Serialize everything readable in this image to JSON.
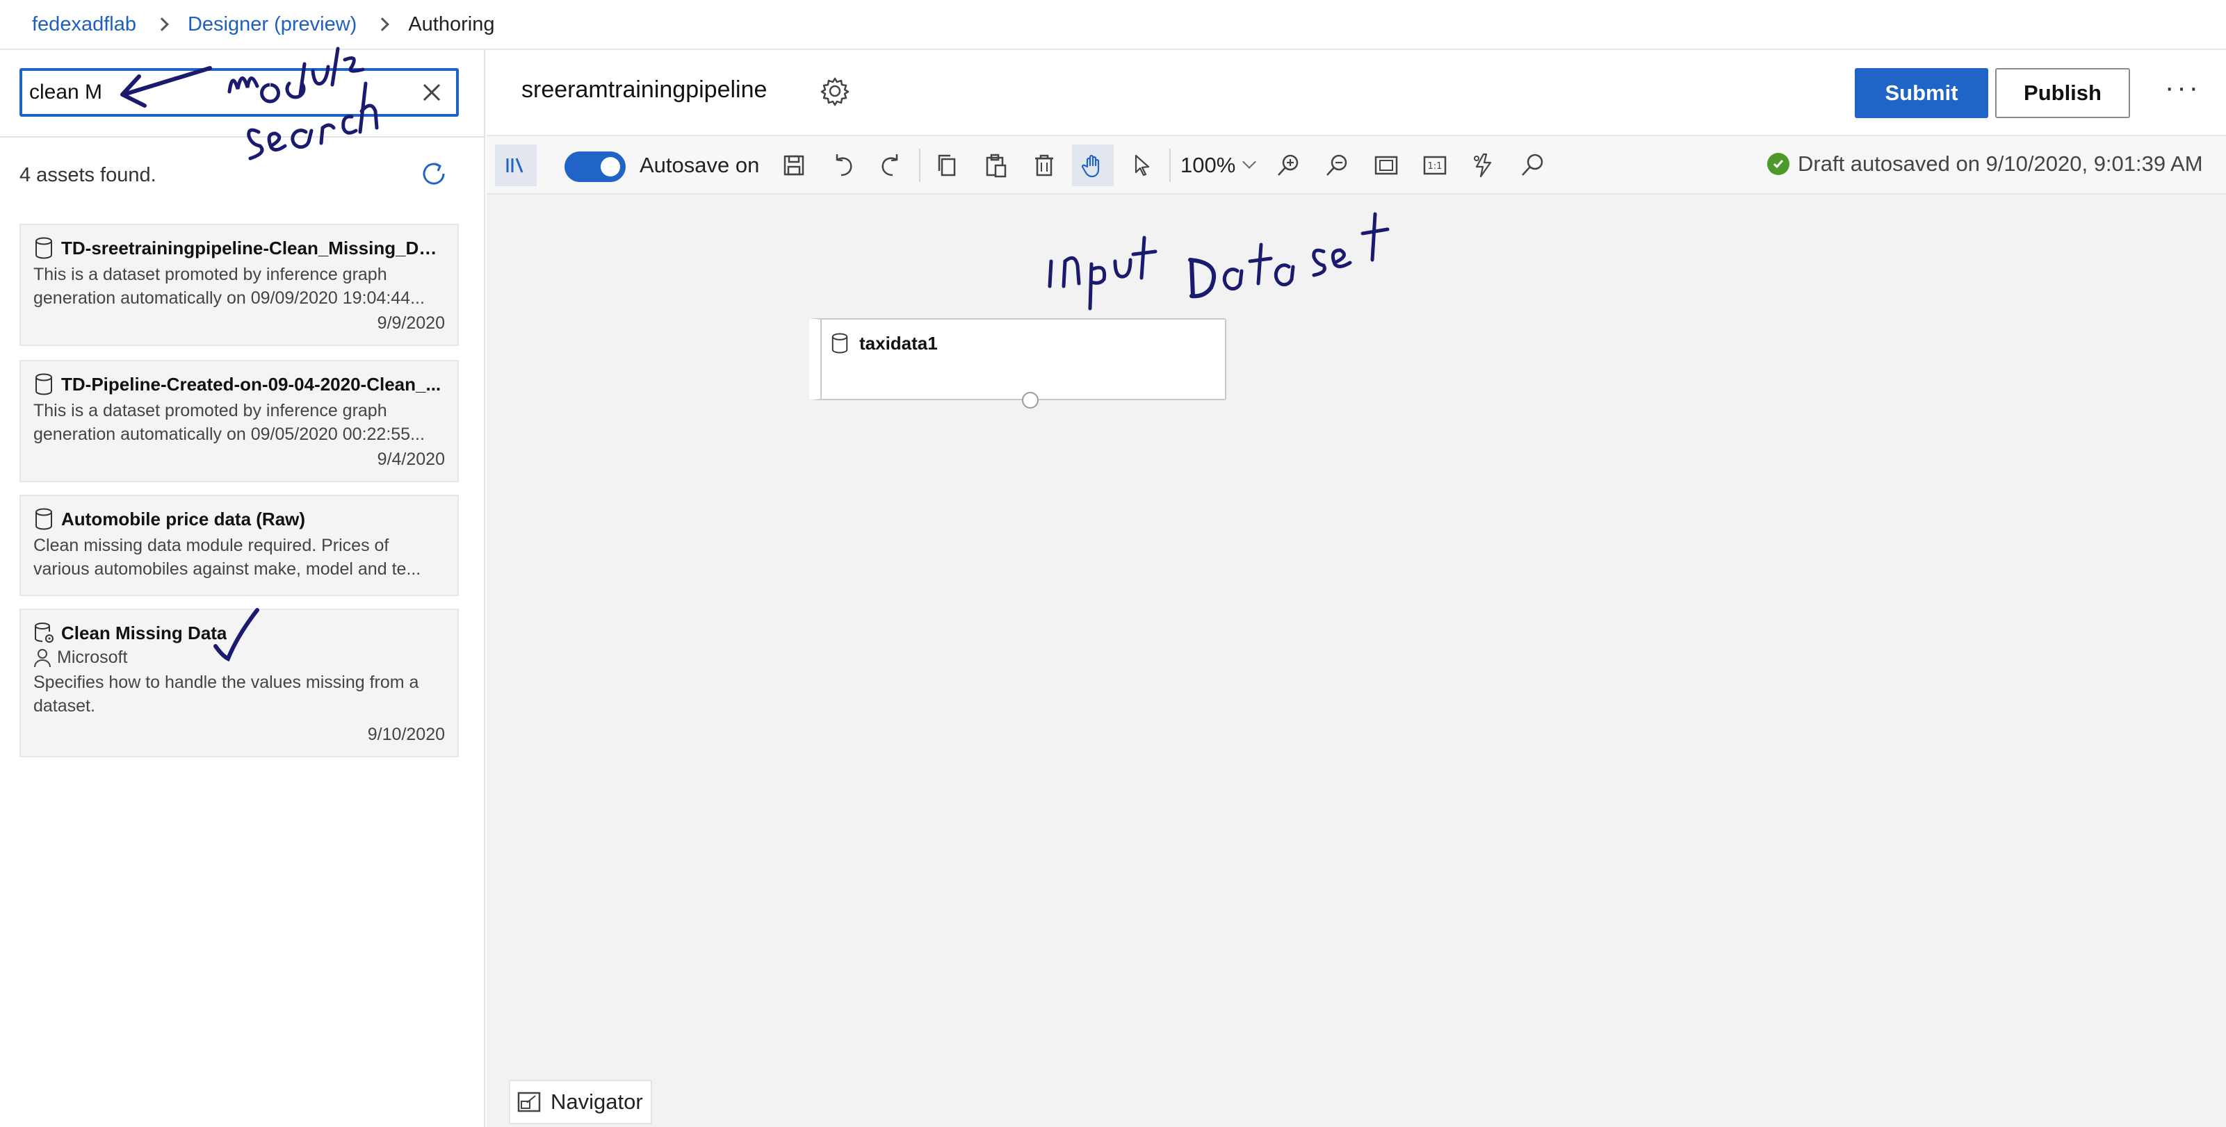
{
  "breadcrumb": {
    "workspace": "fedexadflab",
    "designer": "Designer (preview)",
    "current": "Authoring"
  },
  "left_panel": {
    "search": {
      "value": "clean M",
      "placeholder": ""
    },
    "results_count": "4 assets found.",
    "cards": [
      {
        "icon": "dataset-icon",
        "title": "TD-sreetrainingpipeline-Clean_Missing_Data...",
        "description": "This is a dataset promoted by inference graph generation automatically on 09/09/2020 19:04:44...",
        "date": "9/9/2020"
      },
      {
        "icon": "dataset-icon",
        "title": "TD-Pipeline-Created-on-09-04-2020-Clean_...",
        "description": "This is a dataset promoted by inference graph generation automatically on 09/05/2020 00:22:55...",
        "date": "9/4/2020"
      },
      {
        "icon": "dataset-icon",
        "title": "Automobile price data (Raw)",
        "description": "Clean missing data module required. Prices of various automobiles against make, model and te..."
      },
      {
        "icon": "module-icon",
        "title": "Clean Missing Data",
        "author": "Microsoft",
        "description": "Specifies how to handle the values missing from a dataset.",
        "date": "9/10/2020"
      }
    ]
  },
  "header": {
    "pipeline_name": "sreeramtrainingpipeline",
    "submit_label": "Submit",
    "publish_label": "Publish"
  },
  "toolbar": {
    "autosave_label": "Autosave on",
    "autosave_on": true,
    "zoom": "100%",
    "fit_label": "1:1",
    "status": "Draft autosaved on 9/10/2020, 9:01:39 AM"
  },
  "canvas": {
    "node_title": "taxidata1",
    "navigator_label": "Navigator"
  },
  "colors": {
    "accent": "#2064c8",
    "status_ok": "#4c9a2a",
    "annotation_ink": "#1a1a6e",
    "canvas_bg": "#f2f2f2"
  },
  "annotations": {
    "search_note": "module search",
    "canvas_note": "input Dataset"
  }
}
